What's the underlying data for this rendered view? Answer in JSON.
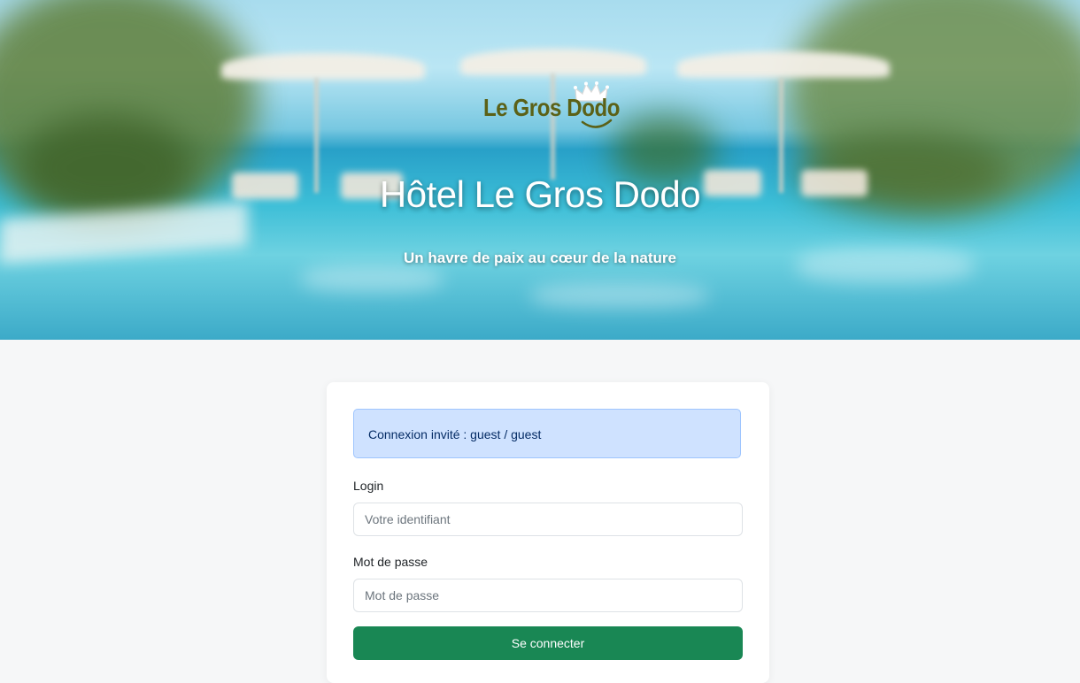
{
  "hero": {
    "logo_text": "Le Gros Dodo",
    "title": "Hôtel Le Gros Dodo",
    "subtitle": "Un havre de paix au cœur de la nature"
  },
  "login_form": {
    "guest_notice": "Connexion invité : guest / guest",
    "login_label": "Login",
    "login_placeholder": "Votre identifiant",
    "password_label": "Mot de passe",
    "password_placeholder": "Mot de passe",
    "submit_label": "Se connecter"
  },
  "colors": {
    "logo_olive": "#5b6117",
    "alert_bg": "#cfe2ff",
    "button_green": "#198754",
    "page_bg": "#f6f7f8"
  }
}
